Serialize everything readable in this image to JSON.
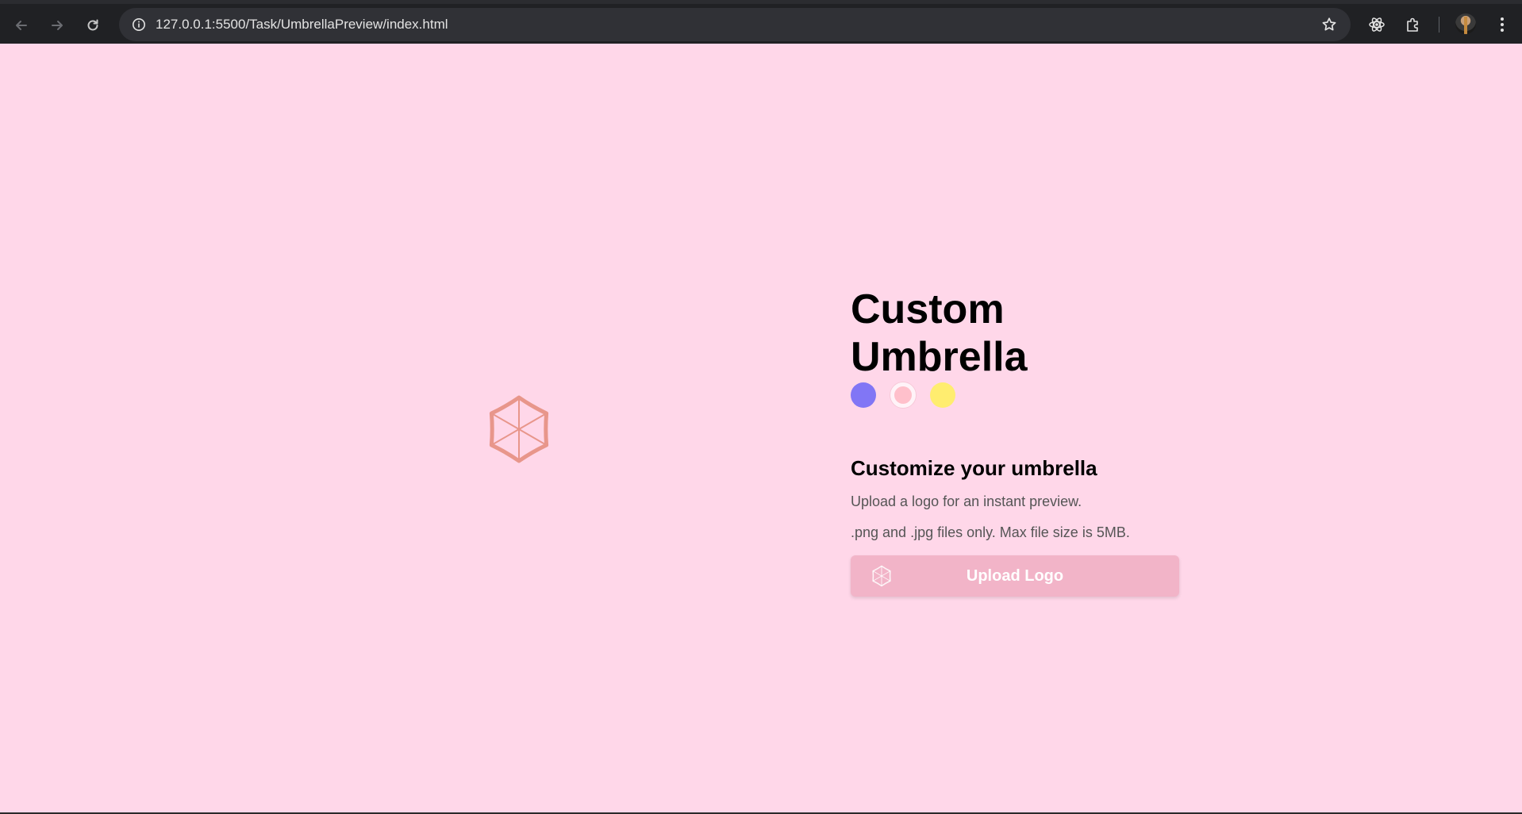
{
  "browser": {
    "url": "127.0.0.1:5500/Task/UmbrellaPreview/index.html",
    "icons": {
      "back": "arrow-left-icon",
      "forward": "arrow-right-icon",
      "reload": "reload-icon",
      "info": "info-icon",
      "bookmark": "star-icon",
      "devtools": "react-icon",
      "extensions": "puzzle-icon",
      "menu": "more-vertical-icon"
    }
  },
  "page": {
    "background": "#ffd7e9",
    "title": "Custom Umbrella",
    "swatches": [
      {
        "name": "purple",
        "color": "#8176f5",
        "selected": false
      },
      {
        "name": "pink",
        "color": "#ffc0cb",
        "selected": true
      },
      {
        "name": "yellow",
        "color": "#ffed6f",
        "selected": false
      }
    ],
    "subtitle": "Customize your umbrella",
    "description": "Upload a logo for an instant preview.",
    "file_note": ".png and .jpg files only. Max file size is 5MB.",
    "upload_button": {
      "label": "Upload Logo",
      "background": "#f2b4c8",
      "icon": "umbrella-icon"
    },
    "umbrella_preview": {
      "icon": "umbrella-icon",
      "color": "#e8968b"
    }
  }
}
